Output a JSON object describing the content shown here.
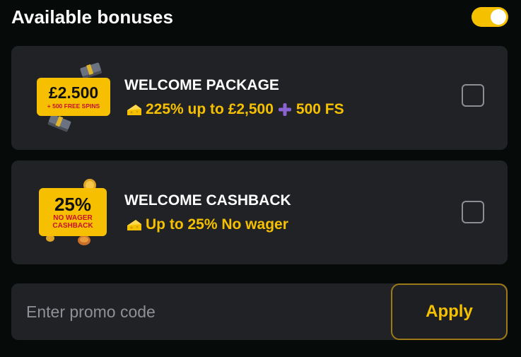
{
  "header": {
    "title": "Available bonuses",
    "toggle_on": true,
    "accent_color": "#f5c000"
  },
  "bonuses": [
    {
      "badge_main": "£2.500",
      "badge_sub": "+ 500 FREE SPINS",
      "title": "WELCOME PACKAGE",
      "desc_part1": "225% up to £2,500",
      "desc_part2": "500 FS",
      "icon": "cheese-icon",
      "checked": false
    },
    {
      "badge_main": "25%",
      "badge_sub_line1": "NO WAGER",
      "badge_sub_line2": "CASHBACK",
      "title": "WELCOME CASHBACK",
      "desc": "Up to 25% No wager",
      "icon": "cheese-icon",
      "checked": false
    }
  ],
  "promo": {
    "placeholder": "Enter promo code",
    "apply_label": "Apply"
  }
}
